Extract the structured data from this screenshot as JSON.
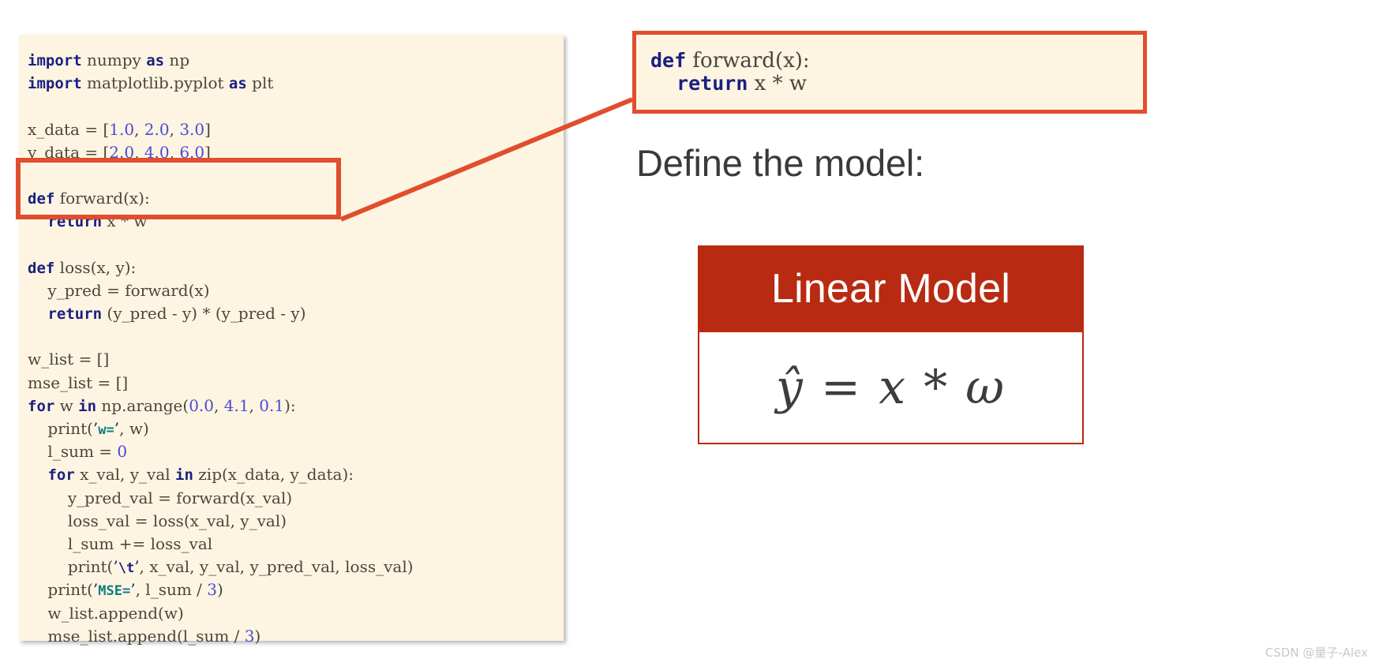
{
  "code_panel": {
    "lines": [
      [
        {
          "t": "import",
          "c": "kw"
        },
        {
          "t": " numpy ",
          "c": "fn"
        },
        {
          "t": "as",
          "c": "kw"
        },
        {
          "t": " np",
          "c": "fn"
        }
      ],
      [
        {
          "t": "import",
          "c": "kw"
        },
        {
          "t": " matplotlib.pyplot ",
          "c": "fn"
        },
        {
          "t": "as",
          "c": "kw"
        },
        {
          "t": " plt",
          "c": "fn"
        }
      ],
      [],
      [
        {
          "t": "x_data = [",
          "c": "fn"
        },
        {
          "t": "1.0",
          "c": "num"
        },
        {
          "t": ", ",
          "c": "fn"
        },
        {
          "t": "2.0",
          "c": "num"
        },
        {
          "t": ", ",
          "c": "fn"
        },
        {
          "t": "3.0",
          "c": "num"
        },
        {
          "t": "]",
          "c": "fn"
        }
      ],
      [
        {
          "t": "y_data = [",
          "c": "fn"
        },
        {
          "t": "2.0",
          "c": "num"
        },
        {
          "t": ", ",
          "c": "fn"
        },
        {
          "t": "4.0",
          "c": "num"
        },
        {
          "t": ", ",
          "c": "fn"
        },
        {
          "t": "6.0",
          "c": "num"
        },
        {
          "t": "]",
          "c": "fn"
        }
      ],
      [],
      [
        {
          "t": "def",
          "c": "kw"
        },
        {
          "t": " forward(x):",
          "c": "fn"
        }
      ],
      [
        {
          "t": "    ",
          "c": "fn"
        },
        {
          "t": "return",
          "c": "kw"
        },
        {
          "t": " x * w",
          "c": "fn"
        }
      ],
      [],
      [
        {
          "t": "def",
          "c": "kw"
        },
        {
          "t": " loss(x, y):",
          "c": "fn"
        }
      ],
      [
        {
          "t": "    y_pred = forward(x)",
          "c": "fn"
        }
      ],
      [
        {
          "t": "    ",
          "c": "fn"
        },
        {
          "t": "return",
          "c": "kw"
        },
        {
          "t": " (y_pred - y) * (y_pred - y)",
          "c": "fn"
        }
      ],
      [],
      [
        {
          "t": "w_list = []",
          "c": "fn"
        }
      ],
      [
        {
          "t": "mse_list = []",
          "c": "fn"
        }
      ],
      [
        {
          "t": "for",
          "c": "kw"
        },
        {
          "t": " w ",
          "c": "fn"
        },
        {
          "t": "in",
          "c": "kw"
        },
        {
          "t": " np.arange(",
          "c": "fn"
        },
        {
          "t": "0.0",
          "c": "num"
        },
        {
          "t": ", ",
          "c": "fn"
        },
        {
          "t": "4.1",
          "c": "num"
        },
        {
          "t": ", ",
          "c": "fn"
        },
        {
          "t": "0.1",
          "c": "num"
        },
        {
          "t": "):",
          "c": "fn"
        }
      ],
      [
        {
          "t": "    print(",
          "c": "fn"
        },
        {
          "t": "’",
          "c": "q"
        },
        {
          "t": "w=",
          "c": "str"
        },
        {
          "t": "’",
          "c": "q"
        },
        {
          "t": ", w)",
          "c": "fn"
        }
      ],
      [
        {
          "t": "    l_sum = ",
          "c": "fn"
        },
        {
          "t": "0",
          "c": "num"
        }
      ],
      [
        {
          "t": "    ",
          "c": "fn"
        },
        {
          "t": "for",
          "c": "kw"
        },
        {
          "t": " x_val, y_val ",
          "c": "fn"
        },
        {
          "t": "in",
          "c": "kw"
        },
        {
          "t": " zip(x_data, y_data):",
          "c": "fn"
        }
      ],
      [
        {
          "t": "        y_pred_val = forward(x_val)",
          "c": "fn"
        }
      ],
      [
        {
          "t": "        loss_val = loss(x_val, y_val)",
          "c": "fn"
        }
      ],
      [
        {
          "t": "        l_sum += loss_val",
          "c": "fn"
        }
      ],
      [
        {
          "t": "        print(",
          "c": "fn"
        },
        {
          "t": "’",
          "c": "q"
        },
        {
          "t": "\\t",
          "c": "esc"
        },
        {
          "t": "’",
          "c": "q"
        },
        {
          "t": ", x_val, y_val, y_pred_val, loss_val)",
          "c": "fn"
        }
      ],
      [
        {
          "t": "    print(",
          "c": "fn"
        },
        {
          "t": "’",
          "c": "q"
        },
        {
          "t": "MSE=",
          "c": "str"
        },
        {
          "t": "’",
          "c": "q"
        },
        {
          "t": ", l_sum / ",
          "c": "fn"
        },
        {
          "t": "3",
          "c": "num"
        },
        {
          "t": ")",
          "c": "fn"
        }
      ],
      [
        {
          "t": "    w_list.append(w)",
          "c": "fn"
        }
      ],
      [
        {
          "t": "    mse_list.append(l_sum / ",
          "c": "fn"
        },
        {
          "t": "3",
          "c": "num"
        },
        {
          "t": ")",
          "c": "fn"
        }
      ]
    ]
  },
  "forward_highlight": {
    "label": "def forward(x): return x * w"
  },
  "callout": {
    "lines": [
      [
        {
          "t": "def",
          "c": "kw"
        },
        {
          "t": " forward(x):",
          "c": "fn"
        }
      ],
      [
        {
          "t": "    ",
          "c": "fn"
        },
        {
          "t": "return",
          "c": "kw"
        },
        {
          "t": " x * w",
          "c": "fn"
        }
      ]
    ]
  },
  "heading": {
    "text": "Define the model:"
  },
  "model_card": {
    "title": "Linear Model",
    "formula": "ŷ = 𝑥 * ω"
  },
  "watermark": {
    "text": "CSDN @量子-Alex"
  },
  "colors": {
    "accent_red": "#e04e2e",
    "card_red": "#b82a11",
    "code_bg": "#fdf5e2",
    "keyword": "#1b1f80",
    "number": "#4b4bd6",
    "string": "#0d7d7d",
    "text": "#4a463c"
  }
}
